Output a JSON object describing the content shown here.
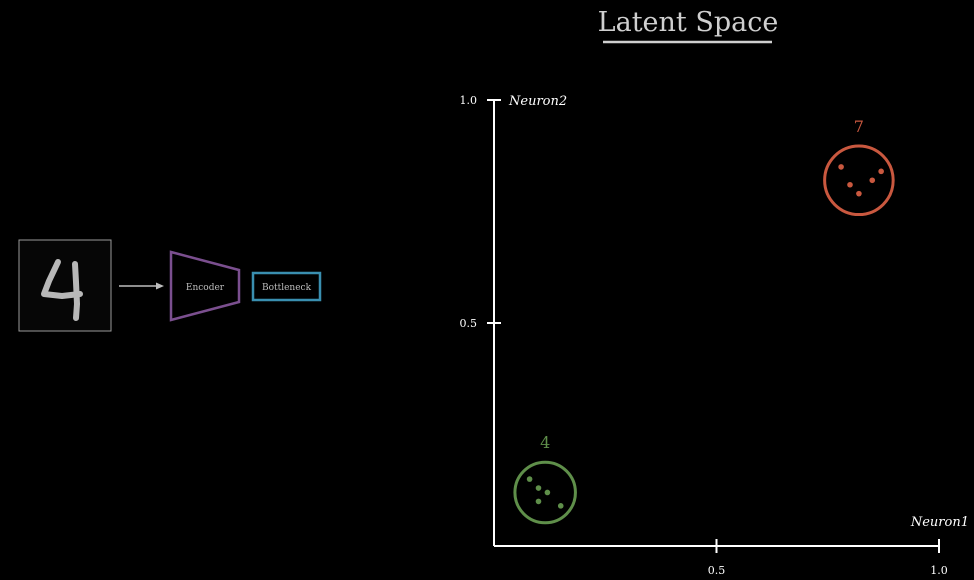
{
  "title": "Latent Space",
  "pipeline": {
    "encoder_label": "Encoder",
    "bottleneck_label": "Bottleneck",
    "input_image_icon": "digit-four-image",
    "arrow_icon": "right-arrow-icon"
  },
  "colors": {
    "background": "#000000",
    "axis": "#ffffff",
    "title": "#cfcfcf",
    "encoder": "#7b4f8f",
    "bottleneck": "#3a8fb0",
    "cluster_seven": "#c9583f",
    "cluster_four": "#5f8f4a",
    "image_border": "#9a9a9a",
    "arrow": "#bdbdbd"
  },
  "chart_data": {
    "type": "scatter",
    "xlabel": "Neuron1",
    "ylabel": "Neuron2",
    "xlim": [
      0,
      1.0
    ],
    "ylim": [
      0,
      1.0
    ],
    "x_ticks": [
      {
        "value": 0.5,
        "label": "0.5"
      },
      {
        "value": 1.0,
        "label": "1.0"
      }
    ],
    "y_ticks": [
      {
        "value": 0.5,
        "label": "0.5"
      },
      {
        "value": 1.0,
        "label": "1.0"
      }
    ],
    "grid": false,
    "clusters": [
      {
        "label": "7",
        "color": "#c9583f",
        "center": [
          0.82,
          0.82
        ],
        "radius": 0.077,
        "points": [
          [
            0.78,
            0.85
          ],
          [
            0.8,
            0.81
          ],
          [
            0.82,
            0.79
          ],
          [
            0.85,
            0.82
          ],
          [
            0.87,
            0.84
          ]
        ]
      },
      {
        "label": "4",
        "color": "#5f8f4a",
        "center": [
          0.115,
          0.12
        ],
        "radius": 0.068,
        "points": [
          [
            0.08,
            0.15
          ],
          [
            0.1,
            0.13
          ],
          [
            0.12,
            0.12
          ],
          [
            0.1,
            0.1
          ],
          [
            0.15,
            0.09
          ]
        ]
      }
    ]
  }
}
